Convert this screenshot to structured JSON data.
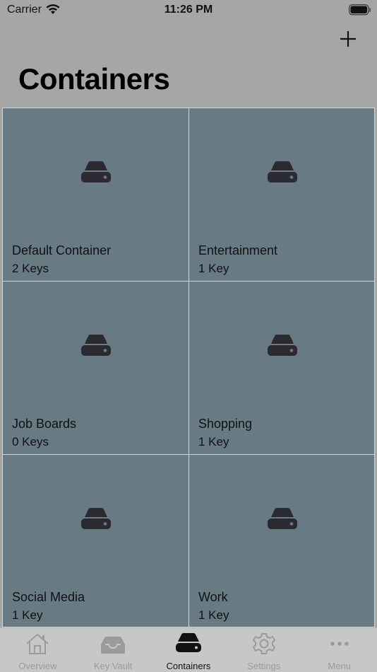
{
  "status": {
    "carrier": "Carrier",
    "time": "11:26 PM"
  },
  "header": {
    "title": "Containers",
    "add_icon": "plus-icon"
  },
  "containers": [
    {
      "name": "Default Container",
      "count": "2 Keys",
      "icon": "drive-icon"
    },
    {
      "name": "Entertainment",
      "count": "1 Key",
      "icon": "drive-icon"
    },
    {
      "name": "Job Boards",
      "count": "0 Keys",
      "icon": "drive-icon"
    },
    {
      "name": "Shopping",
      "count": "1 Key",
      "icon": "drive-icon"
    },
    {
      "name": "Social Media",
      "count": "1 Key",
      "icon": "drive-icon"
    },
    {
      "name": "Work",
      "count": "1 Key",
      "icon": "drive-icon"
    }
  ],
  "tabs": [
    {
      "label": "Overview",
      "icon": "home-icon",
      "active": false
    },
    {
      "label": "Key Vault",
      "icon": "tray-icon",
      "active": false
    },
    {
      "label": "Containers",
      "icon": "drive-icon",
      "active": true
    },
    {
      "label": "Settings",
      "icon": "gear-icon",
      "active": false
    },
    {
      "label": "Menu",
      "icon": "more-icon",
      "active": false
    }
  ],
  "colors": {
    "tile": "#687a84",
    "header": "#a6a7a5",
    "tabbar": "#c6c7c6",
    "active": "#111111",
    "inactive": "#9a9b9b"
  }
}
